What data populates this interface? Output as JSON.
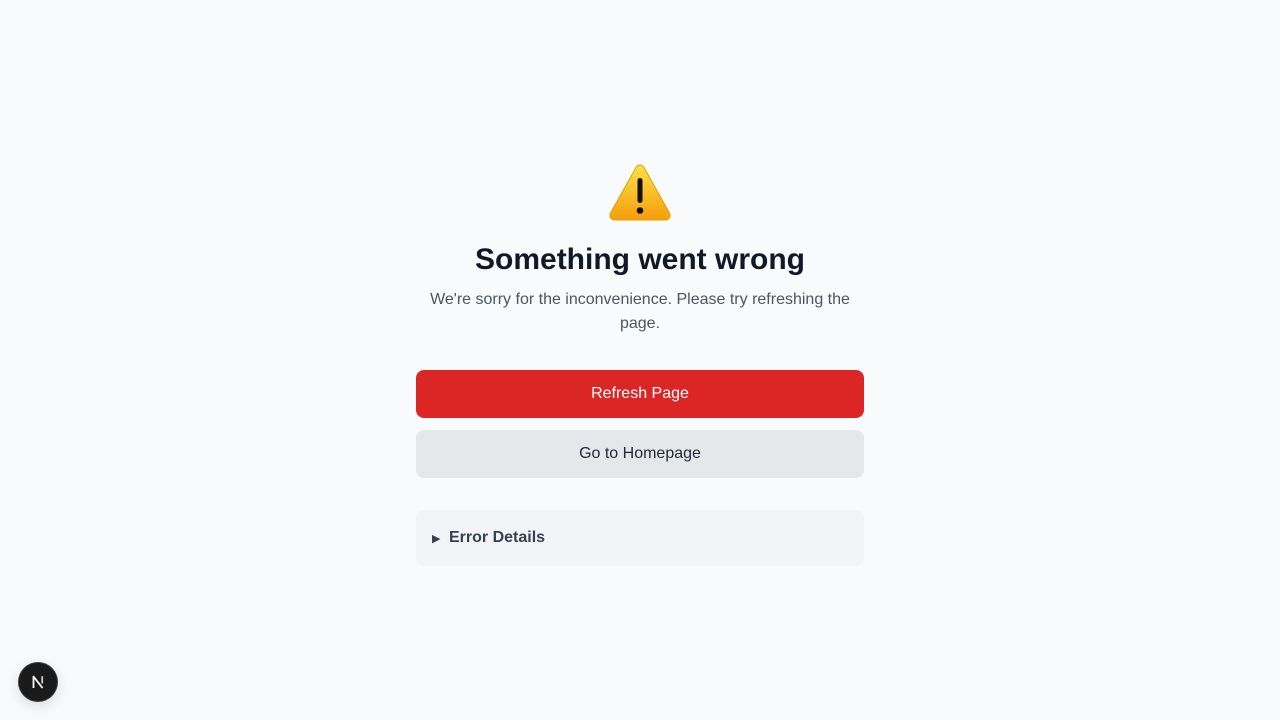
{
  "icons": {
    "warning": "warning-triangle-icon",
    "details_toggle": "triangle-right-icon",
    "dev_badge": "nextjs-logo-icon"
  },
  "error": {
    "title": "Something went wrong",
    "message": "We're sorry for the inconvenience. Please try refreshing the page.",
    "primary_button_label": "Refresh Page",
    "secondary_button_label": "Go to Homepage",
    "details_label": "Error Details",
    "details_arrow": "▶"
  },
  "dev_badge": {
    "letter": "N"
  },
  "colors": {
    "background": "#f8fafc",
    "primary": "#dc2626",
    "secondary": "#e5e7eb",
    "title": "#111827",
    "message": "#4b5563",
    "warning_fill": "#fbbf24"
  }
}
